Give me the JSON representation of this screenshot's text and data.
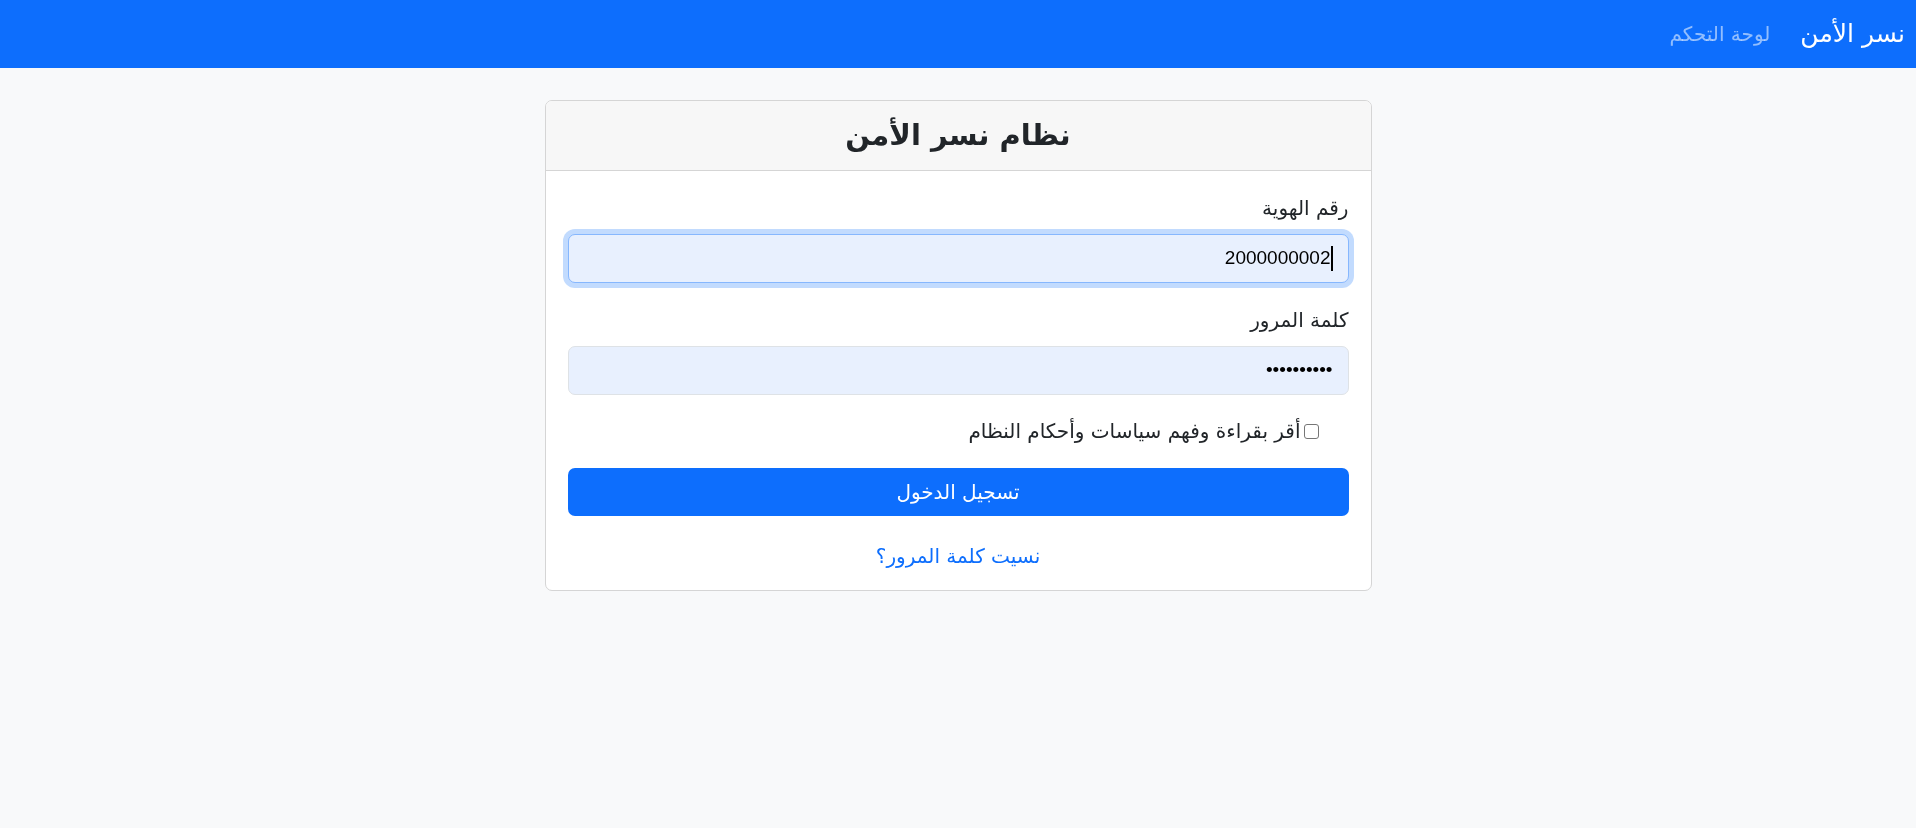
{
  "navbar": {
    "brand": "نسر الأمن",
    "links": [
      {
        "label": "لوحة التحكم",
        "active": false
      }
    ]
  },
  "login_card": {
    "title": "نظام نسر الأمن",
    "fields": [
      {
        "label": "رقم الهوية",
        "value": "2000000002",
        "focused": true,
        "autofilled": true
      },
      {
        "label": "كلمة المرور",
        "value": "••••••••••",
        "focused": false,
        "autofilled": true
      }
    ],
    "agreement": {
      "label": "أقر بقراءة وفهم سياسات وأحكام النظام",
      "checked": false
    },
    "submit_button": "تسجيل الدخول",
    "forgot_link": "نسيت كلمة المرور؟"
  }
}
